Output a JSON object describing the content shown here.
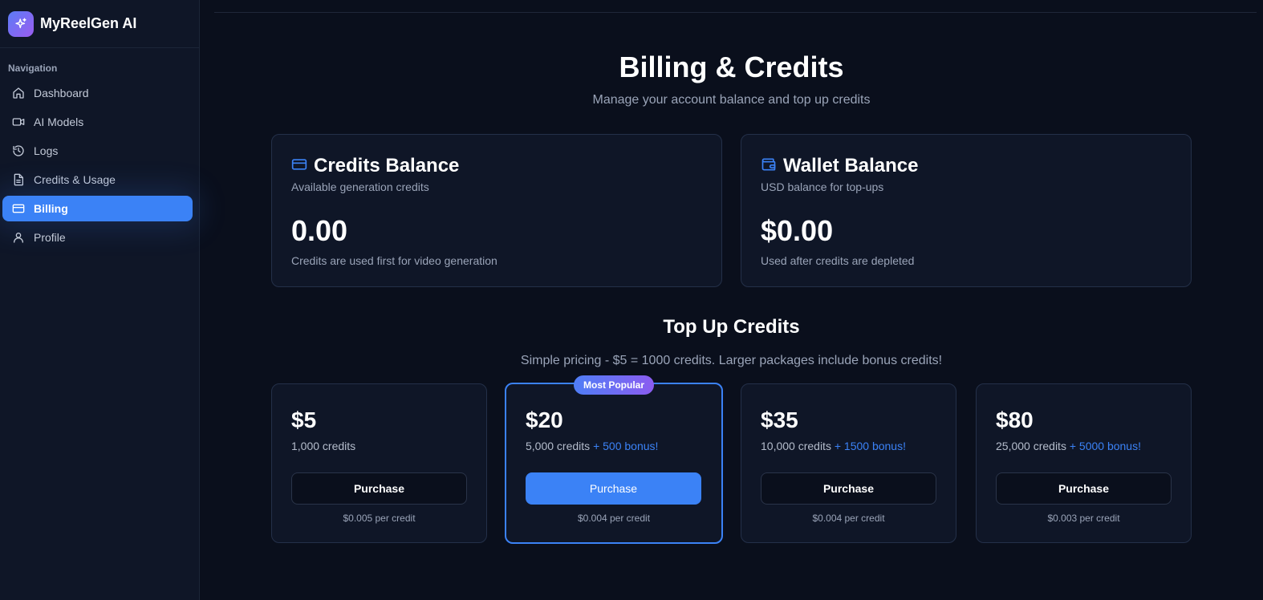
{
  "app": {
    "name": "MyReelGen AI"
  },
  "sidebar": {
    "heading": "Navigation",
    "items": [
      {
        "label": "Dashboard",
        "icon": "home-icon",
        "active": false
      },
      {
        "label": "AI Models",
        "icon": "video-camera-icon",
        "active": false
      },
      {
        "label": "Logs",
        "icon": "history-icon",
        "active": false
      },
      {
        "label": "Credits & Usage",
        "icon": "document-icon",
        "active": false
      },
      {
        "label": "Billing",
        "icon": "credit-card-icon",
        "active": true
      },
      {
        "label": "Profile",
        "icon": "user-icon",
        "active": false
      }
    ]
  },
  "page": {
    "title": "Billing & Credits",
    "subtitle": "Manage your account balance and top up credits"
  },
  "balances": {
    "credits": {
      "title": "Credits Balance",
      "description": "Available generation credits",
      "value": "0.00",
      "note": "Credits are used first for video generation"
    },
    "wallet": {
      "title": "Wallet Balance",
      "description": "USD balance for top-ups",
      "value": "$0.00",
      "note": "Used after credits are depleted"
    }
  },
  "topup": {
    "title": "Top Up Credits",
    "subtitle": "Simple pricing - $5 = 1000 credits. Larger packages include bonus credits!",
    "packages": [
      {
        "price": "$5",
        "credits": "1,000 credits",
        "bonus": "",
        "button": "Purchase",
        "per_credit": "$0.005 per credit",
        "badge": ""
      },
      {
        "price": "$20",
        "credits": "5,000 credits",
        "bonus": "+ 500 bonus!",
        "button": "Purchase",
        "per_credit": "$0.004 per credit",
        "badge": "Most Popular"
      },
      {
        "price": "$35",
        "credits": "10,000 credits",
        "bonus": "+ 1500 bonus!",
        "button": "Purchase",
        "per_credit": "$0.004 per credit",
        "badge": ""
      },
      {
        "price": "$80",
        "credits": "25,000 credits",
        "bonus": "+ 5000 bonus!",
        "button": "Purchase",
        "per_credit": "$0.003 per credit",
        "badge": ""
      }
    ]
  },
  "colors": {
    "accent": "#3b82f6",
    "background": "#0a0f1c",
    "card": "#0f1627",
    "badge_gradient_start": "#4f7ef6",
    "badge_gradient_end": "#8b5cf0"
  }
}
